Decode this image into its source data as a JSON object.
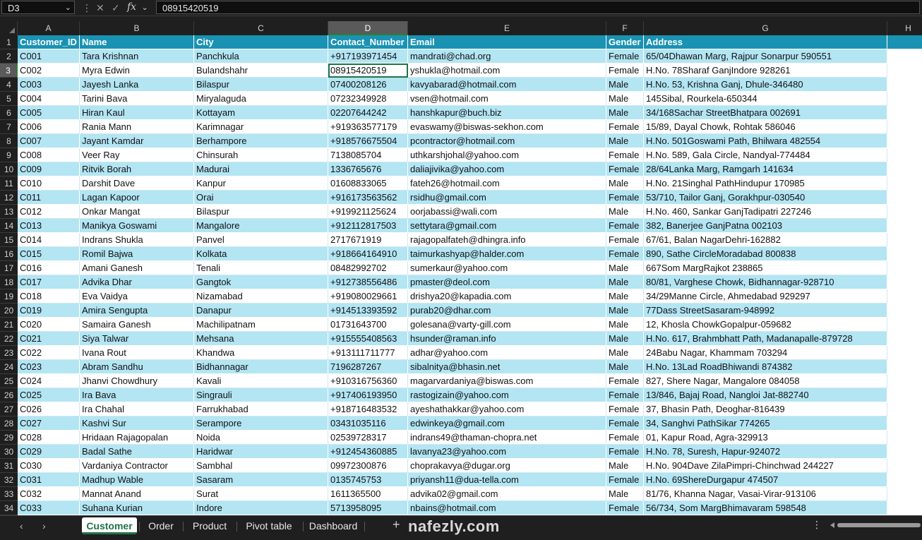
{
  "formula_bar": {
    "name_box": "D3",
    "fx_label": "fx",
    "formula": "08915420519"
  },
  "columns": [
    "A",
    "B",
    "C",
    "D",
    "E",
    "F",
    "G",
    "H"
  ],
  "rows": [
    [
      "Customer_ID",
      "Name",
      "City",
      "Contact_Number",
      "Email",
      "Gender",
      "Address"
    ],
    [
      "C001",
      "Tara Krishnan",
      "Panchkula",
      "+917193971454",
      "mandrati@chad.org",
      "Female",
      "65/04Dhawan Marg, Rajpur Sonarpur 590551"
    ],
    [
      "C002",
      "Myra Edwin",
      "Bulandshahr",
      "08915420519",
      "yshukla@hotmail.com",
      "Female",
      "H.No. 78Sharaf GanjIndore 928261"
    ],
    [
      "C003",
      "Jayesh Lanka",
      "Bilaspur",
      "07400208126",
      "kavyabarad@hotmail.com",
      "Male",
      "H.No. 53, Krishna Ganj, Dhule-346480"
    ],
    [
      "C004",
      "Tarini Bava",
      "Miryalaguda",
      "07232349928",
      "vsen@hotmail.com",
      "Male",
      "145Sibal, Rourkela-650344"
    ],
    [
      "C005",
      "Hiran Kaul",
      "Kottayam",
      "02207644242",
      "hanshkapur@buch.biz",
      "Male",
      "34/168Sachar StreetBhatpara 002691"
    ],
    [
      "C006",
      "Rania Mann",
      "Karimnagar",
      "+919363577179",
      "evaswamy@biswas-sekhon.com",
      "Female",
      "15/89, Dayal Chowk, Rohtak 586046"
    ],
    [
      "C007",
      "Jayant Kamdar",
      "Berhampore",
      "+918576675504",
      "pcontractor@hotmail.com",
      "Male",
      "H.No. 501Goswami Path, Bhilwara 482554"
    ],
    [
      "C008",
      "Veer Ray",
      "Chinsurah",
      "7138085704",
      "uthkarshjohal@yahoo.com",
      "Female",
      "H.No. 589, Gala Circle, Nandyal-774484"
    ],
    [
      "C009",
      "Ritvik Borah",
      "Madurai",
      "1336765676",
      "daliajivika@yahoo.com",
      "Female",
      "28/64Lanka Marg, Ramgarh 141634"
    ],
    [
      "C010",
      "Darshit Dave",
      "Kanpur",
      "01608833065",
      "fateh26@hotmail.com",
      "Male",
      "H.No. 21Singhal PathHindupur 170985"
    ],
    [
      "C011",
      "Lagan Kapoor",
      "Orai",
      "+916173563562",
      "rsidhu@gmail.com",
      "Female",
      "53/710, Tailor Ganj, Gorakhpur-030540"
    ],
    [
      "C012",
      "Onkar Mangat",
      "Bilaspur",
      "+919921125624",
      "oorjabassi@wali.com",
      "Male",
      "H.No. 460, Sankar GanjTadipatri 227246"
    ],
    [
      "C013",
      "Manikya Goswami",
      "Mangalore",
      "+912112817503",
      "settytara@gmail.com",
      "Female",
      "382, Banerjee GanjPatna 002103"
    ],
    [
      "C014",
      "Indrans Shukla",
      "Panvel",
      "2717671919",
      "rajagopalfateh@dhingra.info",
      "Female",
      "67/61, Balan NagarDehri-162882"
    ],
    [
      "C015",
      "Romil Bajwa",
      "Kolkata",
      "+918664164910",
      "taimurkashyap@halder.com",
      "Female",
      "890, Sathe CircleMoradabad 800838"
    ],
    [
      "C016",
      "Amani Ganesh",
      "Tenali",
      "08482992702",
      "sumerkaur@yahoo.com",
      "Male",
      "667Som MargRajkot 238865"
    ],
    [
      "C017",
      "Advika Dhar",
      "Gangtok",
      "+912738556486",
      "pmaster@deol.com",
      "Male",
      "80/81, Varghese Chowk, Bidhannagar-928710"
    ],
    [
      "C018",
      "Eva Vaidya",
      "Nizamabad",
      "+919080029661",
      "drishya20@kapadia.com",
      "Male",
      "34/29Manne Circle, Ahmedabad 929297"
    ],
    [
      "C019",
      "Amira Sengupta",
      "Danapur",
      "+914513393592",
      "purab20@dhar.com",
      "Male",
      "77Dass StreetSasaram-948992"
    ],
    [
      "C020",
      "Samaira Ganesh",
      "Machilipatnam",
      "01731643700",
      "golesana@varty-gill.com",
      "Male",
      "12, Khosla ChowkGopalpur-059682"
    ],
    [
      "C021",
      "Siya Talwar",
      "Mehsana",
      "+915555408563",
      "hsunder@raman.info",
      "Male",
      "H.No. 617, Brahmbhatt Path, Madanapalle-879728"
    ],
    [
      "C022",
      "Ivana Rout",
      "Khandwa",
      "+913111711777",
      "adhar@yahoo.com",
      "Male",
      "24Babu Nagar, Khammam 703294"
    ],
    [
      "C023",
      "Abram Sandhu",
      "Bidhannagar",
      "7196287267",
      "sibalnitya@bhasin.net",
      "Male",
      "H.No. 13Lad RoadBhiwandi 874382"
    ],
    [
      "C024",
      "Jhanvi Chowdhury",
      "Kavali",
      "+910316756360",
      "magarvardaniya@biswas.com",
      "Female",
      "827, Shere Nagar, Mangalore 084058"
    ],
    [
      "C025",
      "Ira Bava",
      "Singrauli",
      "+917406193950",
      "rastogizain@yahoo.com",
      "Female",
      "13/846, Bajaj Road, Nangloi Jat-882740"
    ],
    [
      "C026",
      "Ira Chahal",
      "Farrukhabad",
      "+918716483532",
      "ayeshathakkar@yahoo.com",
      "Female",
      "37, Bhasin Path, Deoghar-816439"
    ],
    [
      "C027",
      "Kashvi Sur",
      "Serampore",
      "03431035116",
      "edwinkeya@gmail.com",
      "Female",
      "34, Sanghvi PathSikar 774265"
    ],
    [
      "C028",
      "Hridaan Rajagopalan",
      "Noida",
      "02539728317",
      "indrans49@thaman-chopra.net",
      "Female",
      "01, Kapur Road, Agra-329913"
    ],
    [
      "C029",
      "Badal Sathe",
      "Haridwar",
      "+912454360885",
      "lavanya23@yahoo.com",
      "Female",
      "H.No. 78, Suresh, Hapur-924072"
    ],
    [
      "C030",
      "Vardaniya Contractor",
      "Sambhal",
      "09972300876",
      "choprakavya@dugar.org",
      "Male",
      "H.No. 904Dave ZilaPimpri-Chinchwad 244227"
    ],
    [
      "C031",
      "Madhup Wable",
      "Sasaram",
      "0135745753",
      "priyansh11@dua-tella.com",
      "Female",
      "H.No. 69ShereDurgapur 474507"
    ],
    [
      "C032",
      "Mannat Anand",
      "Surat",
      "1611365500",
      "advika02@gmail.com",
      "Male",
      "81/76, Khanna Nagar, Vasai-Virar-913106"
    ],
    [
      "C033",
      "Suhana Kurian",
      "Indore",
      "5713958095",
      "nbains@hotmail.com",
      "Female",
      "56/734, Som MargBhimavaram 598548"
    ]
  ],
  "sheet_tabs": [
    "Customer",
    "Order",
    "Product",
    "Pivot table",
    "Dashboard"
  ],
  "active_tab": "Customer",
  "watermark": "nafezly.com",
  "colors": {
    "header_bg": "#1a92b3",
    "band_bg": "#b3e5f3",
    "accent_green": "#217346"
  }
}
